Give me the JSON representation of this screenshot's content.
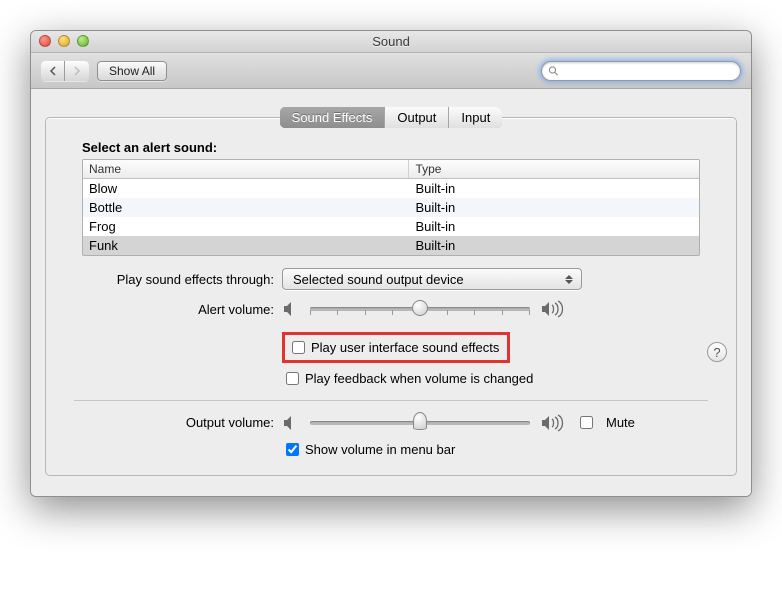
{
  "window": {
    "title": "Sound"
  },
  "toolbar": {
    "show_all": "Show All",
    "search_placeholder": ""
  },
  "tabs": [
    {
      "label": "Sound Effects",
      "active": true
    },
    {
      "label": "Output",
      "active": false
    },
    {
      "label": "Input",
      "active": false
    }
  ],
  "alert_section_label": "Select an alert sound:",
  "columns": {
    "name": "Name",
    "type": "Type"
  },
  "sounds": [
    {
      "name": "Blow",
      "type": "Built-in",
      "selected": false
    },
    {
      "name": "Bottle",
      "type": "Built-in",
      "selected": false
    },
    {
      "name": "Frog",
      "type": "Built-in",
      "selected": false
    },
    {
      "name": "Funk",
      "type": "Built-in",
      "selected": true
    }
  ],
  "play_through": {
    "label": "Play sound effects through:",
    "value": "Selected sound output device"
  },
  "alert_volume": {
    "label": "Alert volume:",
    "value": 0.5
  },
  "ui_sounds": {
    "label": "Play user interface sound effects",
    "checked": false
  },
  "feedback": {
    "label": "Play feedback when volume is changed",
    "checked": false
  },
  "output_volume": {
    "label": "Output volume:",
    "value": 0.5
  },
  "mute": {
    "label": "Mute",
    "checked": false
  },
  "menubar": {
    "label": "Show volume in menu bar",
    "checked": true
  }
}
